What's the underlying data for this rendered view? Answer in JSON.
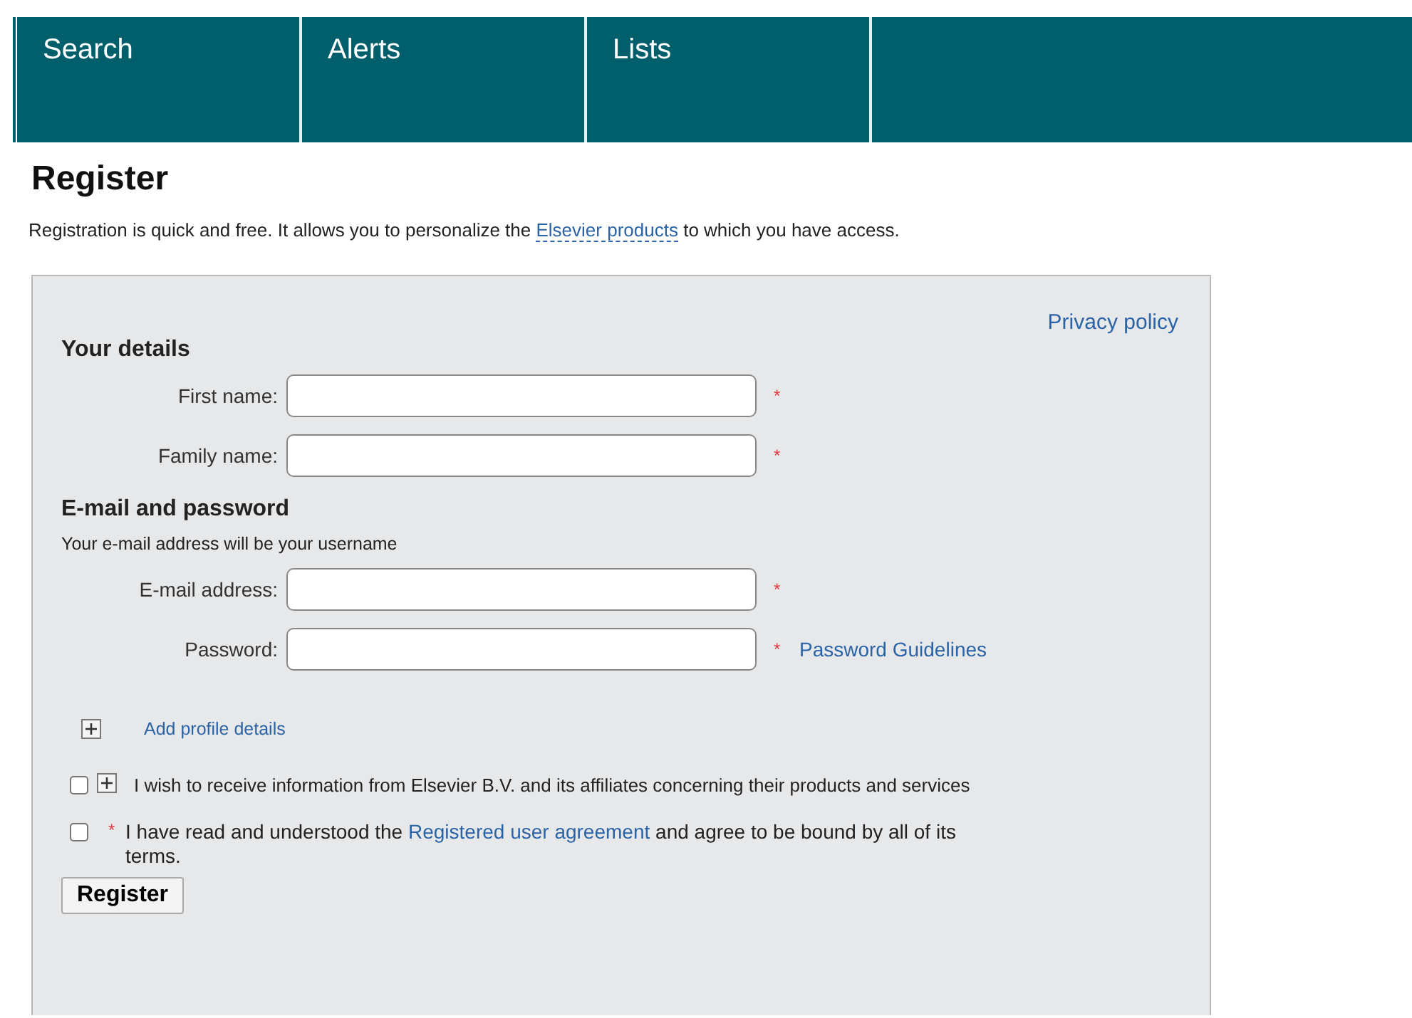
{
  "nav": {
    "tabs": [
      {
        "label": "Search",
        "selected": false
      },
      {
        "label": "Alerts",
        "selected": false
      },
      {
        "label": "Lists",
        "selected": false
      }
    ]
  },
  "page": {
    "title": "Register",
    "intro": {
      "before": "Registration is quick and free. It allows you to personalize the ",
      "link": "Elsevier products",
      "after": " to which you have access."
    }
  },
  "form": {
    "privacy_link": "Privacy policy",
    "sections": [
      {
        "heading": "Your details",
        "fields": [
          {
            "label": "First name:",
            "marker": "*"
          },
          {
            "label": "Family name:",
            "marker": "*"
          }
        ]
      },
      {
        "heading": "E-mail and password",
        "note": "Your e-mail address will be your username",
        "fields": [
          {
            "label": "E-mail address:",
            "marker": "*"
          },
          {
            "label": "Password:",
            "marker": "*",
            "link": "Password Guidelines"
          }
        ]
      }
    ],
    "profile": {
      "label": "Add profile details",
      "expanded": false
    },
    "consents": [
      {
        "checked": false,
        "expander": true,
        "before": "I wish to receive information from Elsevier B.V. and its affiliates concerning their products and services"
      },
      {
        "checked": false,
        "expander": false,
        "marker": "*",
        "before": "I have read and understood the ",
        "link": "Registered user agreement",
        "after": " and agree to be bound by all of its terms."
      }
    ],
    "submit": "Register"
  }
}
